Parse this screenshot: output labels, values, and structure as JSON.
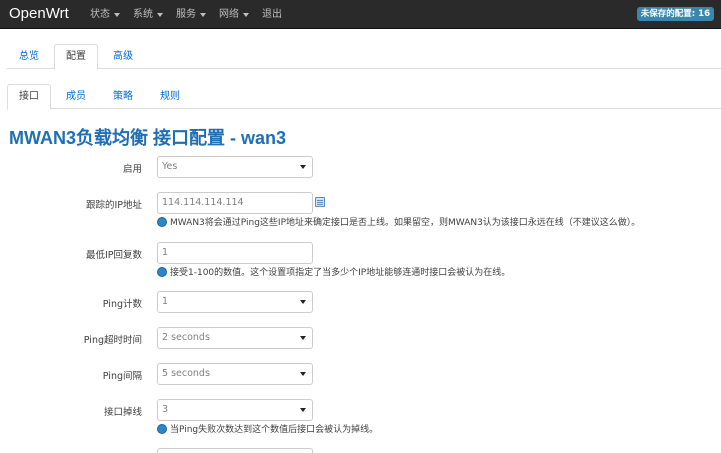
{
  "navbar": {
    "brand": "OpenWrt",
    "menu": [
      {
        "label": "状态",
        "has_caret": true
      },
      {
        "label": "系统",
        "has_caret": true
      },
      {
        "label": "服务",
        "has_caret": true
      },
      {
        "label": "网络",
        "has_caret": true
      },
      {
        "label": "退出",
        "has_caret": false
      }
    ],
    "unsaved_badge": "未保存的配置: 16"
  },
  "tabs_level1": [
    {
      "label": "总览",
      "active": false
    },
    {
      "label": "配置",
      "active": true
    },
    {
      "label": "高级",
      "active": false
    }
  ],
  "tabs_level2": [
    {
      "label": "接口",
      "active": true
    },
    {
      "label": "成员",
      "active": false
    },
    {
      "label": "策略",
      "active": false
    },
    {
      "label": "规则",
      "active": false
    }
  ],
  "page_title": "MWAN3负载均衡 接口配置 - wan3",
  "form": {
    "enabled": {
      "label": "启用",
      "value": "Yes"
    },
    "track_ip": {
      "label": "跟踪的IP地址",
      "value": "114.114.114.114",
      "help": "MWAN3将会通过Ping这些IP地址来确定接口是否上线。如果留空，则MWAN3认为该接口永远在线（不建议这么做）。"
    },
    "reliability": {
      "label": "最低IP回复数",
      "value": "1",
      "help": "接受1-100的数值。这个设置项指定了当多少个IP地址能够连通时接口会被认为在线。"
    },
    "ping_count": {
      "label": "Ping计数",
      "value": "1"
    },
    "ping_timeout": {
      "label": "Ping超时时间",
      "value": "2 seconds"
    },
    "ping_interval": {
      "label": "Ping间隔",
      "value": "5 seconds"
    },
    "down": {
      "label": "接口掉线",
      "value": "3",
      "help": "当Ping失败次数达到这个数值后接口会被认为掉线。"
    }
  },
  "colors": {
    "navbar": "#2a2a2a",
    "link": "#0069d6",
    "title": "#1f6fb5",
    "badge": "#3a87ad"
  },
  "icons": {
    "help": "info-circle-icon",
    "add": "add-entry-icon"
  }
}
